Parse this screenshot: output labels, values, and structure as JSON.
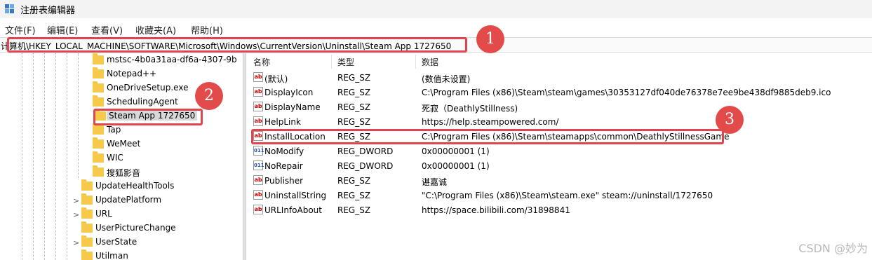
{
  "window": {
    "title": "注册表编辑器",
    "icon": "regedit-icon"
  },
  "menu": [
    "文件(F)",
    "编辑(E)",
    "查看(V)",
    "收藏夹(A)",
    "帮助(H)"
  ],
  "address": {
    "path": "计算机\\HKEY_LOCAL_MACHINE\\SOFTWARE\\Microsoft\\Windows\\CurrentVersion\\Uninstall\\Steam App 1727650"
  },
  "annotations": [
    "1",
    "2",
    "3"
  ],
  "tree": {
    "items": [
      {
        "label": "mstsc-4b0a31aa-df6a-4307-9b",
        "expander": ""
      },
      {
        "label": "Notepad++",
        "expander": ""
      },
      {
        "label": "OneDriveSetup.exe",
        "expander": ""
      },
      {
        "label": "SchedulingAgent",
        "expander": ""
      },
      {
        "label": "Steam App 1727650",
        "expander": "",
        "selected": true
      },
      {
        "label": "Tap",
        "expander": ""
      },
      {
        "label": "WeMeet",
        "expander": ""
      },
      {
        "label": "WIC",
        "expander": ""
      },
      {
        "label": "搜狐影音",
        "expander": ""
      },
      {
        "label": "UpdateHealthTools",
        "expander": ""
      },
      {
        "label": "UpdatePlatform",
        "expander": ">"
      },
      {
        "label": "URL",
        "expander": ">"
      },
      {
        "label": "UserPictureChange",
        "expander": ""
      },
      {
        "label": "UserState",
        "expander": ">"
      },
      {
        "label": "Utilman",
        "expander": ""
      }
    ]
  },
  "values": {
    "columns": [
      "名称",
      "类型",
      "数据"
    ],
    "rows": [
      {
        "name": "(默认)",
        "type": "REG_SZ",
        "data": "(数值未设置)",
        "icon": "ab"
      },
      {
        "name": "DisplayIcon",
        "type": "REG_SZ",
        "data": "C:\\Program Files (x86)\\Steam\\steam\\games\\30353127df040de76378e7ee9be438df9885deb9.ico",
        "icon": "ab"
      },
      {
        "name": "DisplayName",
        "type": "REG_SZ",
        "data": "死寂（DeathlyStillness)",
        "icon": "ab"
      },
      {
        "name": "HelpLink",
        "type": "REG_SZ",
        "data": "https://help.steampowered.com/",
        "icon": "ab"
      },
      {
        "name": "InstallLocation",
        "type": "REG_SZ",
        "data": "C:\\Program Files (x86)\\Steam\\steamapps\\common\\DeathlyStillnessGame",
        "icon": "ab"
      },
      {
        "name": "NoModify",
        "type": "REG_DWORD",
        "data": "0x00000001 (1)",
        "icon": "dword"
      },
      {
        "name": "NoRepair",
        "type": "REG_DWORD",
        "data": "0x00000001 (1)",
        "icon": "dword"
      },
      {
        "name": "Publisher",
        "type": "REG_SZ",
        "data": "谌嘉诚",
        "icon": "ab"
      },
      {
        "name": "UninstallString",
        "type": "REG_SZ",
        "data": "\"C:\\Program Files (x86)\\Steam\\steam.exe\" steam://uninstall/1727650",
        "icon": "ab"
      },
      {
        "name": "URLInfoAbout",
        "type": "REG_SZ",
        "data": "https://space.bilibili.com/31898841",
        "icon": "ab"
      }
    ]
  },
  "watermark": "CSDN @妙为",
  "colors": {
    "highlight": "#e0454f",
    "badge": "#e34b4b",
    "folder": "#f7c94a"
  }
}
